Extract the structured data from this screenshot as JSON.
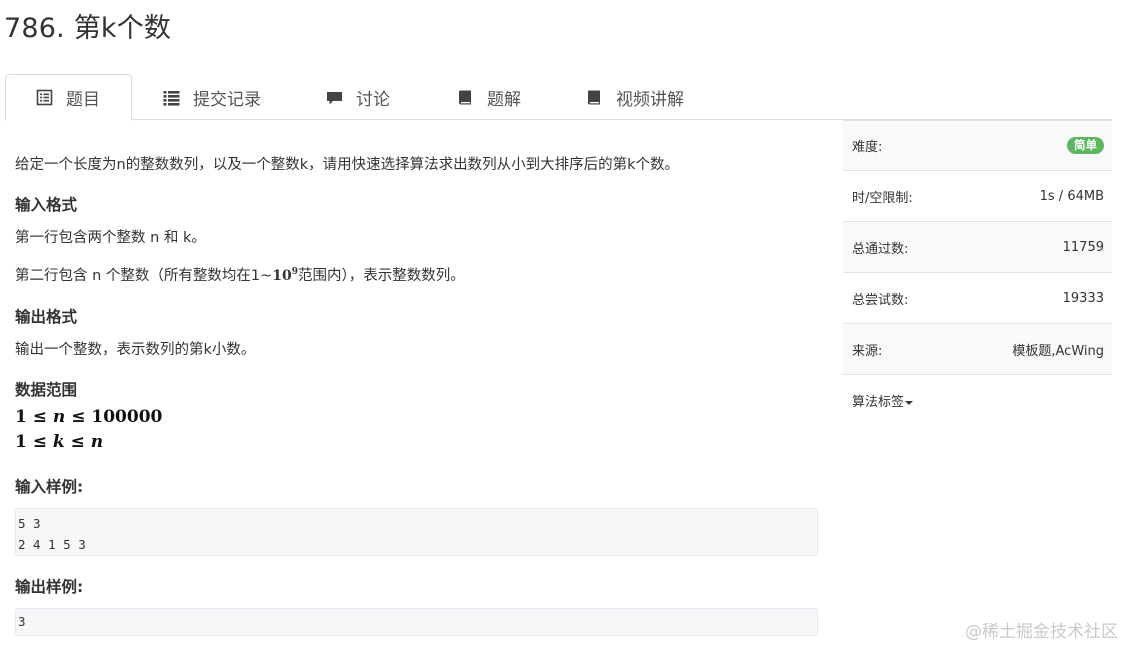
{
  "header": {
    "title": "786. 第k个数"
  },
  "tabs": [
    {
      "label": "题目",
      "icon": "list-alt-icon",
      "active": true
    },
    {
      "label": "提交记录",
      "icon": "list-icon"
    },
    {
      "label": "讨论",
      "icon": "comment-icon"
    },
    {
      "label": "题解",
      "icon": "book-icon"
    },
    {
      "label": "视频讲解",
      "icon": "book-icon"
    }
  ],
  "problem": {
    "description": "给定一个长度为n的整数数列，以及一个整数k，请用快速选择算法求出数列从小到大排序后的第k个数。",
    "input_heading": "输入格式",
    "input_line1": "第一行包含两个整数 n 和 k。",
    "input_line2_pre": "第二行包含 n 个整数（所有整数均在1~",
    "input_line2_base": "10",
    "input_line2_exp": "9",
    "input_line2_post": "范围内），表示整数数列。",
    "output_heading": "输出格式",
    "output_line": "输出一个整数，表示数列的第k小数。",
    "range_heading": "数据范围",
    "range_line1": {
      "lhs": "1 ≤ ",
      "var": "n",
      "rhs": " ≤ 100000"
    },
    "range_line2": {
      "lhs": "1 ≤ ",
      "var": "k",
      "mid": " ≤ ",
      "var2": "n"
    },
    "sample_input_heading": "输入样例:",
    "sample_input": "5 3\n2 4 1 5 3",
    "sample_output_heading": "输出样例:",
    "sample_output": "3"
  },
  "sidebar": {
    "difficulty_label": "难度:",
    "difficulty_value": "简单",
    "limit_label": "时/空限制:",
    "limit_value": "1s / 64MB",
    "passed_label": "总通过数:",
    "passed_value": "11759",
    "attempts_label": "总尝试数:",
    "attempts_value": "19333",
    "source_label": "来源:",
    "source_value": "模板题,AcWing",
    "tags_label": "算法标签"
  },
  "watermark": "@稀土掘金技术社区",
  "colors": {
    "badge_green": "#5cb85c",
    "border": "#dddddd"
  }
}
